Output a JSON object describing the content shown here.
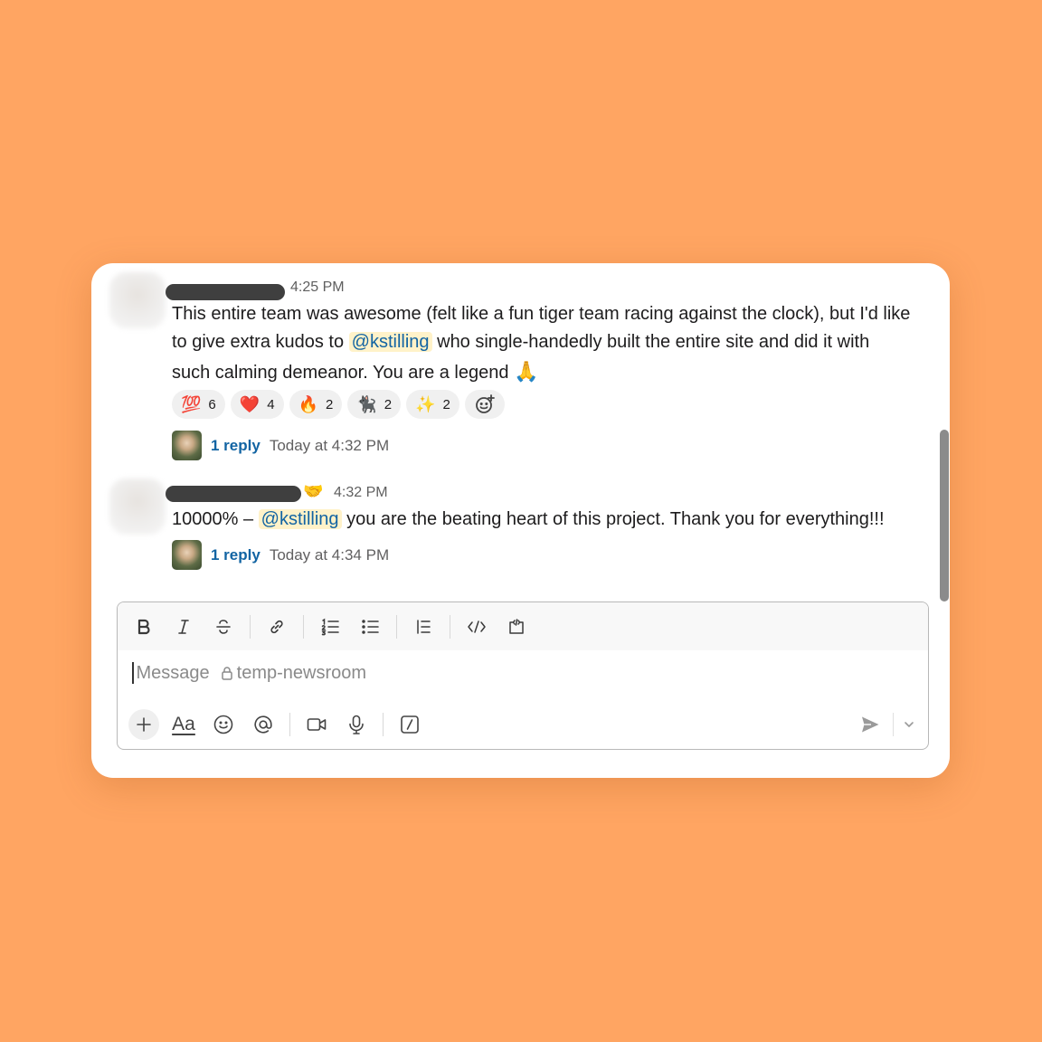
{
  "messages": [
    {
      "time": "4:25 PM",
      "line1": "This entire team was awesome (felt like a fun tiger team racing against the clock), but I'd like",
      "line2_before": "to give extra kudos to ",
      "mention": "@kstilling",
      "line2_after": " who single-handedly built the entire site and did it with",
      "line3": "such calming demeanor. You are a legend ",
      "line3_emoji": "🙏",
      "reactions": [
        {
          "emoji": "💯",
          "count": "6"
        },
        {
          "emoji": "❤️",
          "count": "4"
        },
        {
          "emoji": "🔥",
          "count": "2"
        },
        {
          "emoji": "🐈‍⬛",
          "count": "2"
        },
        {
          "emoji": "✨",
          "count": "2"
        }
      ],
      "reply_count": "1 reply",
      "reply_time": "Today at 4:32 PM"
    },
    {
      "name_emoji": "🤝",
      "time": "4:32 PM",
      "text_before": "10000% – ",
      "mention": "@kstilling",
      "text_after": " you are the beating heart of this project. Thank you for everything!!!",
      "reply_count": "1 reply",
      "reply_time": "Today at 4:34 PM"
    }
  ],
  "composer": {
    "placeholder": "Message",
    "channel": "temp-newsroom",
    "aa_label": "Aa"
  },
  "icons": {
    "bold": "bold-icon",
    "italic": "italic-icon",
    "strike": "strikethrough-icon",
    "link": "link-icon",
    "ordered": "ordered-list-icon",
    "bullet": "bullet-list-icon",
    "quote": "blockquote-icon",
    "code": "code-icon",
    "codeblock": "code-block-icon",
    "plus": "plus-icon",
    "emoji": "emoji-icon",
    "mention": "at-mention-icon",
    "video": "video-icon",
    "mic": "microphone-icon",
    "slash": "slash-command-icon",
    "send": "send-icon",
    "chevron": "chevron-down-icon",
    "lock": "lock-icon"
  },
  "colors": {
    "background": "#FFA562",
    "mention_bg": "#FFF2C9",
    "link": "#1264A3"
  }
}
